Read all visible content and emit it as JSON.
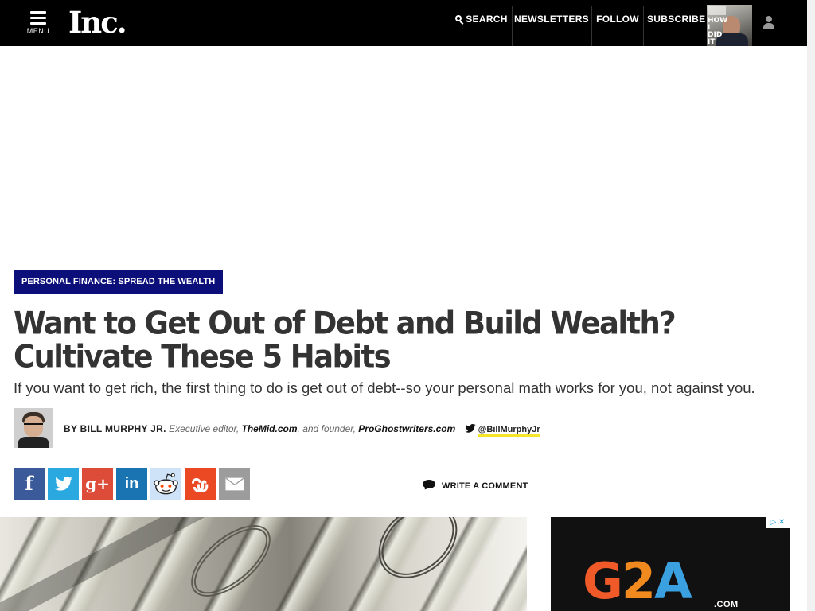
{
  "header": {
    "menu_label": "MENU",
    "logo_text": "Inc.",
    "nav": {
      "search_label": "SEARCH",
      "newsletters_label": "NEWSLETTERS",
      "follow_label": "FOLLOW",
      "subscribe_label": "SUBSCRIBE"
    },
    "magazine_cover": {
      "cover_text": "HOW I DID IT"
    }
  },
  "article": {
    "category": "PERSONAL FINANCE: SPREAD THE WEALTH",
    "headline": "Want to Get Out of Debt and Build Wealth? Cultivate These 5 Habits",
    "dek": "If you want to get rich, the first thing to do is get out of debt--so your personal math works for you, not against you.",
    "byline": {
      "name": "BY BILL MURPHY JR.",
      "role_prefix": "Executive editor,",
      "site_1": "TheMid.com",
      "role_middle": ", and founder,",
      "site_2": "ProGhostwriters.com",
      "twitter_handle": "@BillMurphyJr"
    },
    "share": {
      "facebook": "f",
      "twitter": "t",
      "googleplus": "g+",
      "linkedin": "in",
      "reddit": "reddit",
      "stumbleupon": "su",
      "email": "email"
    },
    "comment_label": "WRITE A COMMENT"
  },
  "sidebar_ad": {
    "logo_g": "G",
    "logo_2": "2",
    "logo_a": "A",
    "logo_sub": ".COM",
    "adchoices": "▷ ✕"
  },
  "colors": {
    "category_bg": "#0c0f7a",
    "facebook": "#3b5a9a",
    "twitter": "#2aa9e0",
    "googleplus": "#dd4b39",
    "linkedin": "#1a74b2",
    "reddit": "#cee3f8",
    "stumbleupon": "#eb4924",
    "email": "#9c9c9c",
    "twitter_handle_underline": "#f5e62c"
  }
}
